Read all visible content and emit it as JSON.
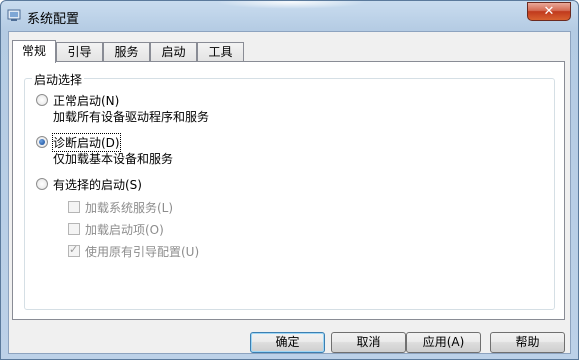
{
  "window": {
    "title": "系统配置",
    "close_label": "✕"
  },
  "tabs": [
    {
      "label": "常规",
      "active": true
    },
    {
      "label": "引导",
      "active": false
    },
    {
      "label": "服务",
      "active": false
    },
    {
      "label": "启动",
      "active": false
    },
    {
      "label": "工具",
      "active": false
    }
  ],
  "startup": {
    "group_label": "启动选择",
    "normal": {
      "label": "正常启动(N)",
      "desc": "加载所有设备驱动程序和服务",
      "checked": false
    },
    "diagnostic": {
      "label": "诊断启动(D)",
      "desc": "仅加载基本设备和服务",
      "checked": true
    },
    "selective": {
      "label": "有选择的启动(S)",
      "checked": false,
      "options": [
        {
          "label": "加载系统服务(L)",
          "checked": false,
          "enabled": false
        },
        {
          "label": "加载启动项(O)",
          "checked": false,
          "enabled": false
        },
        {
          "label": "使用原有引导配置(U)",
          "checked": true,
          "enabled": false
        }
      ]
    }
  },
  "buttons": {
    "ok": "确定",
    "cancel": "取消",
    "apply": "应用(A)",
    "help": "帮助"
  },
  "colors": {
    "titlebar": "#b4cbe3",
    "close": "#c0391d",
    "radio_checked": "#1a4f9c"
  }
}
